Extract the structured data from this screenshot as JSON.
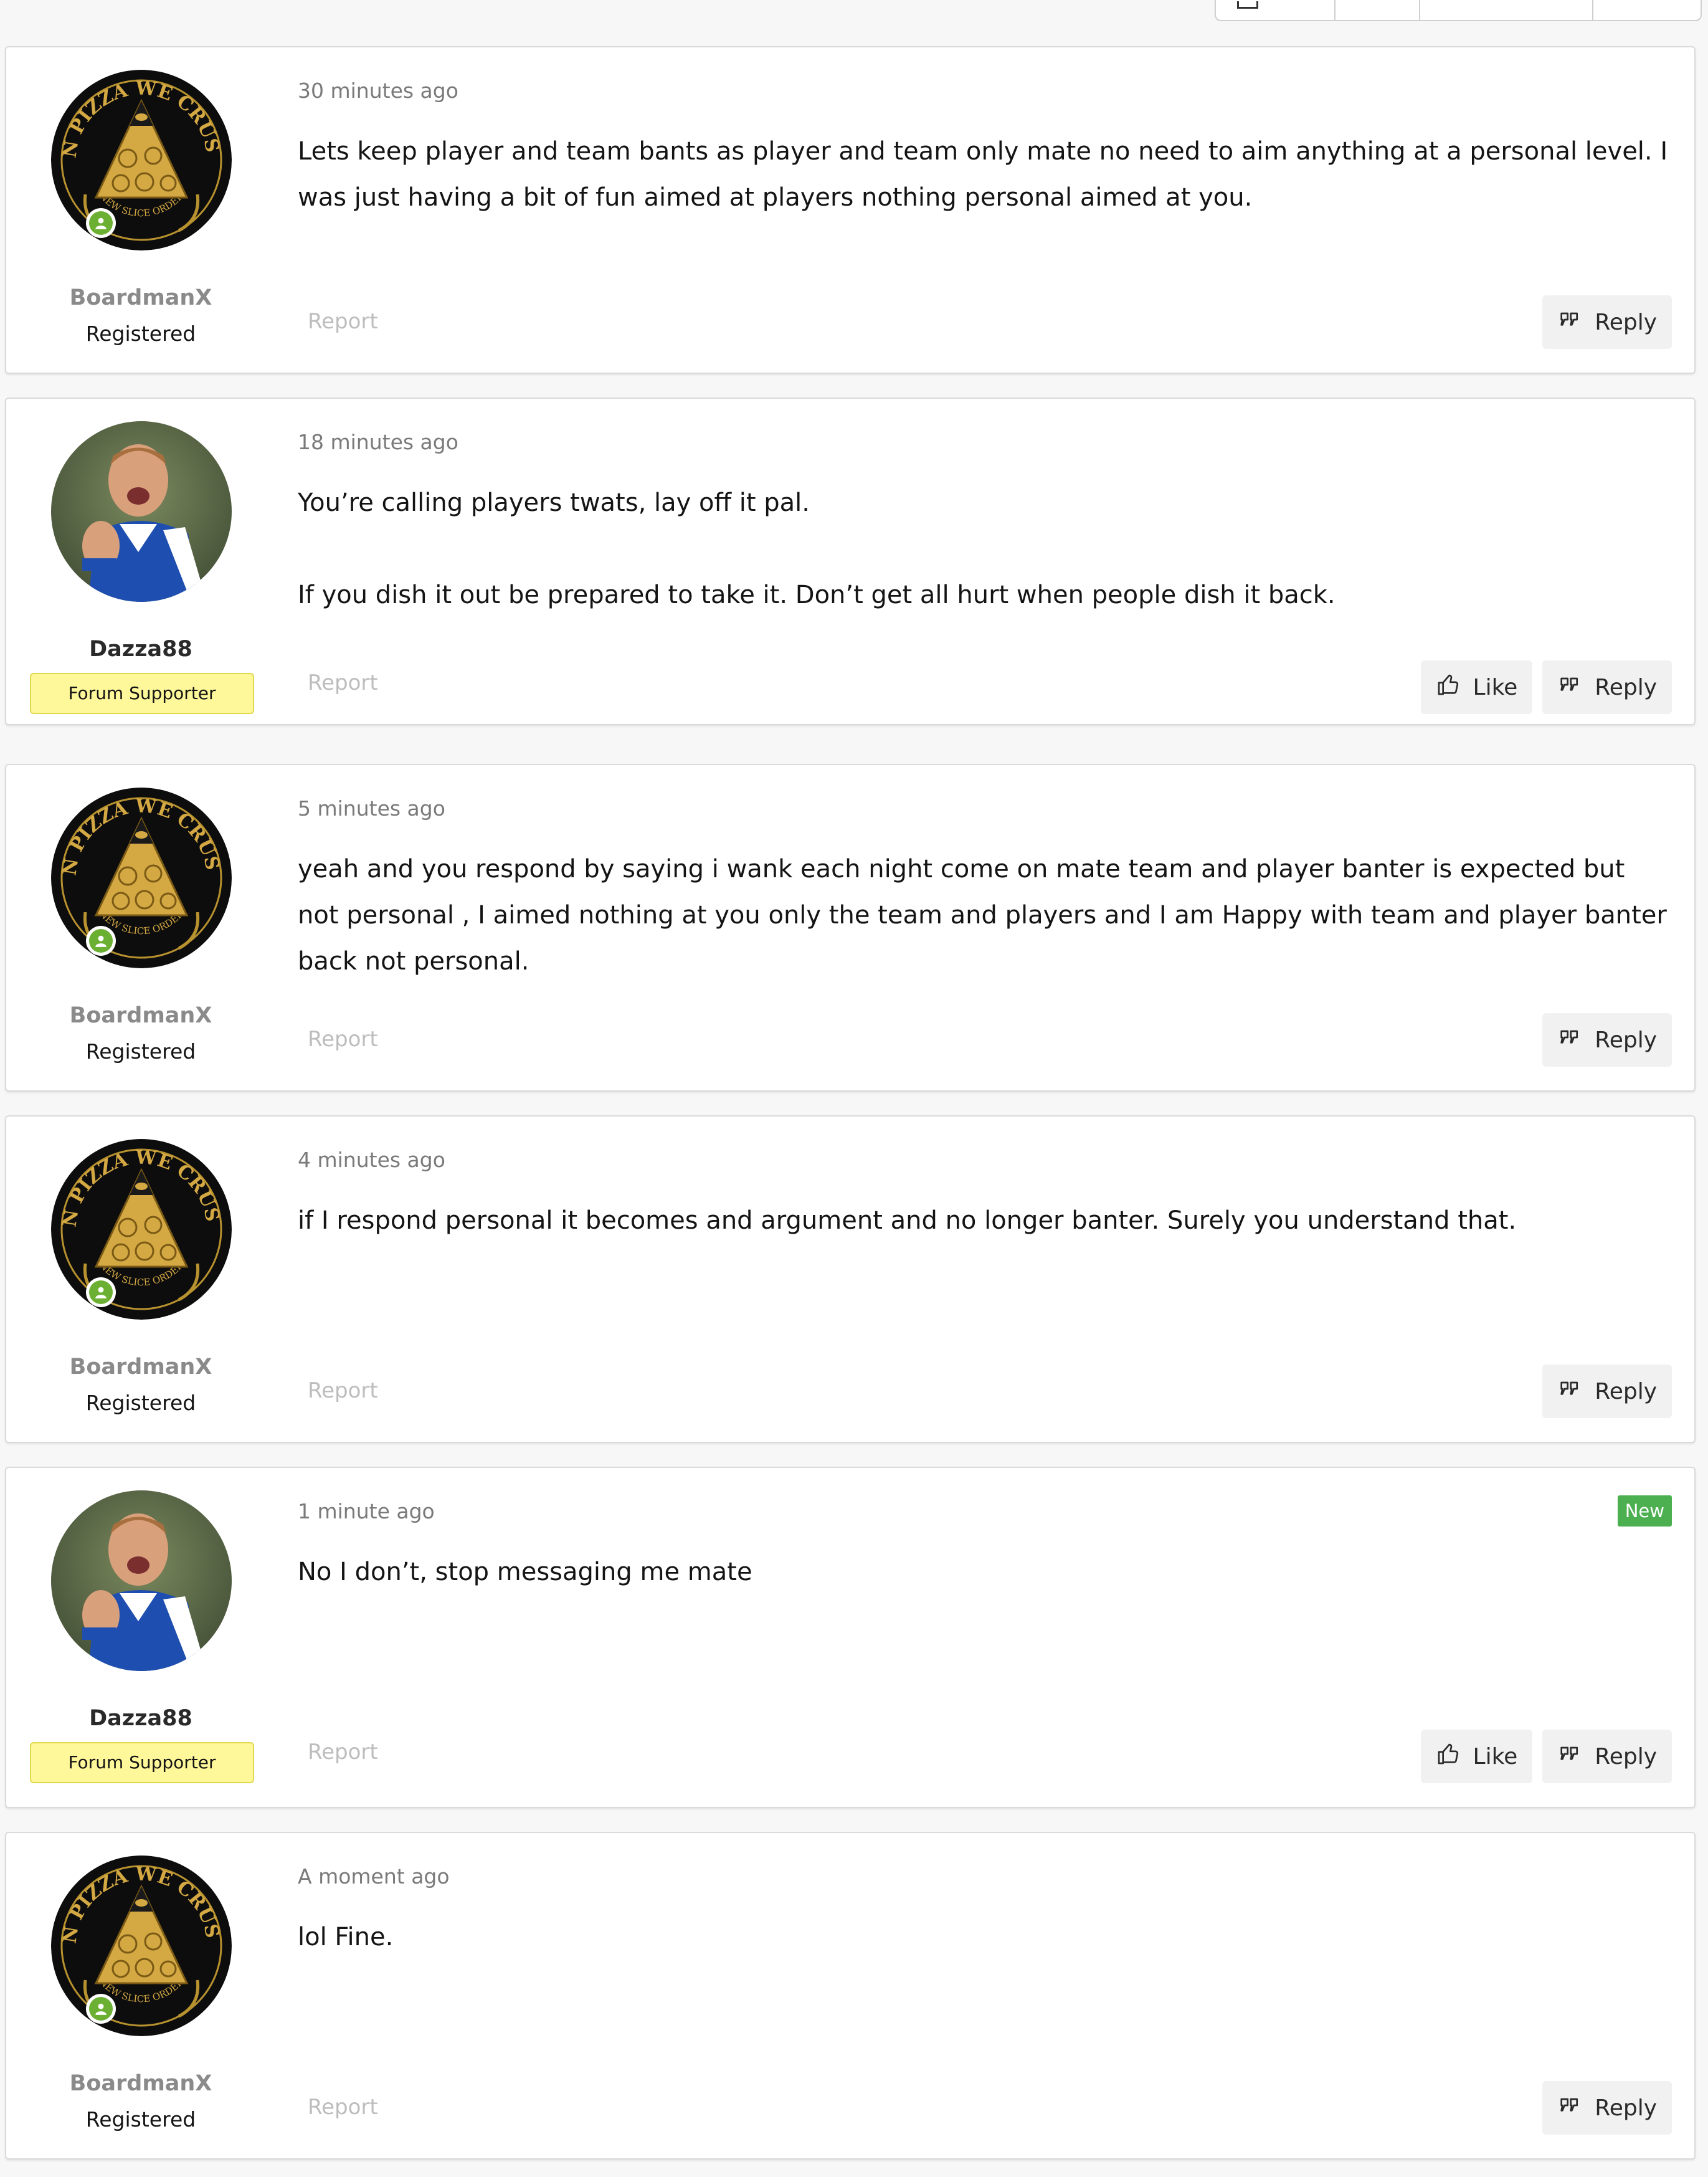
{
  "posts": [
    {
      "user": "BoardmanX",
      "role": "Registered",
      "avatar": "pizza-logo",
      "time": "30 minutes ago",
      "message": "Lets keep player and team bants as player and team only mate no need to aim anything at a personal level. I was just having a bit of fun aimed at players nothing personal aimed at you.",
      "report": "Report",
      "reply": "Reply"
    },
    {
      "user": "Dazza88",
      "badge": "Forum Supporter",
      "avatar": "footballer",
      "time": "18 minutes ago",
      "message": "You’re calling players twats, lay off it pal.\n\nIf you dish it out be prepared to take it. Don’t get all hurt when people dish it back.",
      "report": "Report",
      "like": "Like",
      "reply": "Reply"
    },
    {
      "user": "BoardmanX",
      "role": "Registered",
      "avatar": "pizza-logo",
      "time": "5 minutes ago",
      "message": "yeah and you respond by saying i wank each night come on mate team and player banter is expected but not personal , I aimed nothing at you only the team and players and I am Happy with team and player banter back not personal.",
      "report": "Report",
      "reply": "Reply"
    },
    {
      "user": "BoardmanX",
      "role": "Registered",
      "avatar": "pizza-logo",
      "time": "4 minutes ago",
      "message": "if I respond personal it becomes and argument and no longer banter. Surely you understand that.",
      "report": "Report",
      "reply": "Reply"
    },
    {
      "user": "Dazza88",
      "badge": "Forum Supporter",
      "avatar": "footballer",
      "time": "1 minute ago",
      "new": "New",
      "message": "No I don’t, stop messaging me mate",
      "report": "Report",
      "like": "Like",
      "reply": "Reply"
    },
    {
      "user": "BoardmanX",
      "role": "Registered",
      "avatar": "pizza-logo",
      "time": "A moment ago",
      "message": "lol Fine.",
      "report": "Report",
      "reply": "Reply"
    }
  ],
  "avatar_logo_text": {
    "top": "IN PIZZA WE CRUST",
    "bottom": "NEW SLICE ORDER"
  },
  "colors": {
    "online": "#6cb033",
    "supporter_badge": "#fff89a",
    "new_badge": "#4caf50"
  }
}
